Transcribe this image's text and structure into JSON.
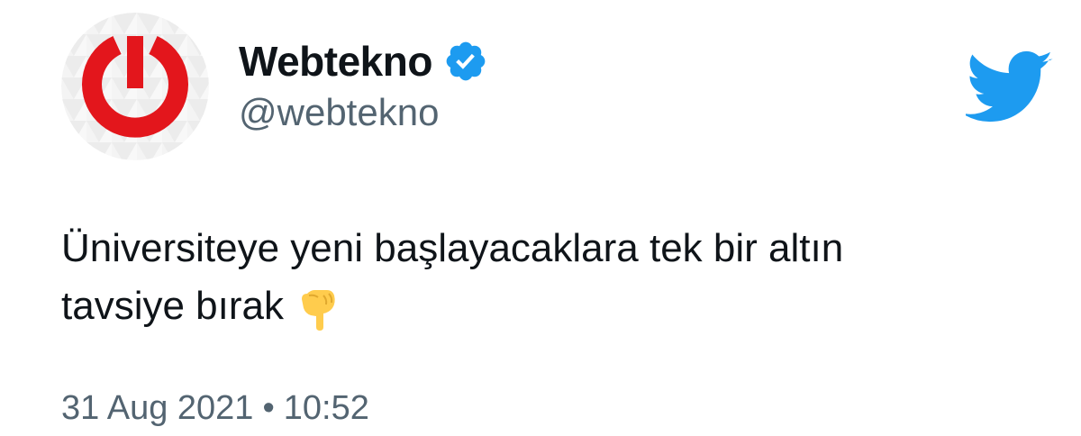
{
  "author": {
    "display_name": "Webtekno",
    "handle": "@webtekno",
    "verified": true,
    "avatar_icon": "power-button-logo-icon"
  },
  "tweet": {
    "text": "Üniversiteye yeni başlayacaklara tek bir altın\ntavsiye bırak",
    "emoji": "backhand-index-pointing-down-icon"
  },
  "meta": {
    "date": "31 Aug 2021",
    "separator": "•",
    "time": "10:52"
  },
  "colors": {
    "twitter_blue": "#1d9bf0",
    "brand_red": "#e3161c",
    "secondary_text": "#536471",
    "emoji_yellow": "#ffcc4d"
  },
  "icons": {
    "brand": "twitter-bird-icon",
    "verified": "verified-badge-icon"
  }
}
